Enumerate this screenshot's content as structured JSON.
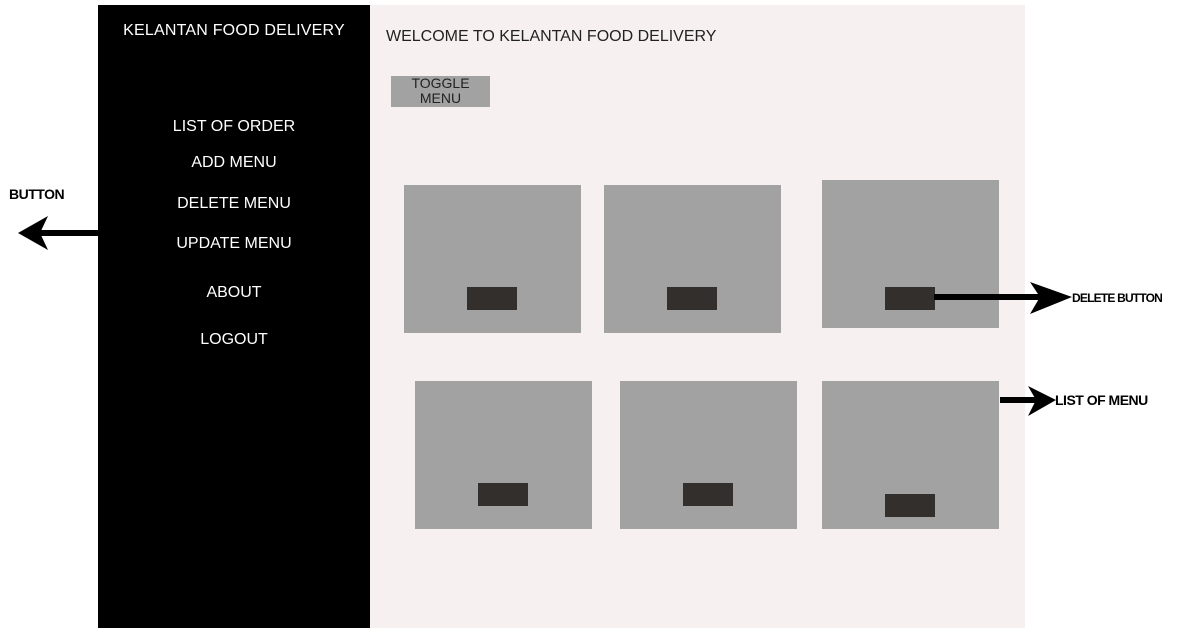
{
  "sidebar": {
    "title": "KELANTAN FOOD DELIVERY",
    "items": [
      {
        "label": "LIST OF ORDER"
      },
      {
        "label": "ADD MENU"
      },
      {
        "label": "DELETE MENU"
      },
      {
        "label": "UPDATE MENU"
      },
      {
        "label": "ABOUT"
      },
      {
        "label": "LOGOUT"
      }
    ]
  },
  "main": {
    "welcome": "WELCOME TO KELANTAN FOOD DELIVERY",
    "toggle_label": "TOGGLE MENU",
    "menu_cards": 6
  },
  "annotations": {
    "button": "BUTTON",
    "delete_button": "DELETE BUTTON",
    "list_of_menu": "LIST OF MENU"
  },
  "colors": {
    "sidebar_bg": "#000000",
    "main_bg": "#f7f0f0",
    "card_bg": "#a2a2a2",
    "delete_button_bg": "#332f2c"
  }
}
